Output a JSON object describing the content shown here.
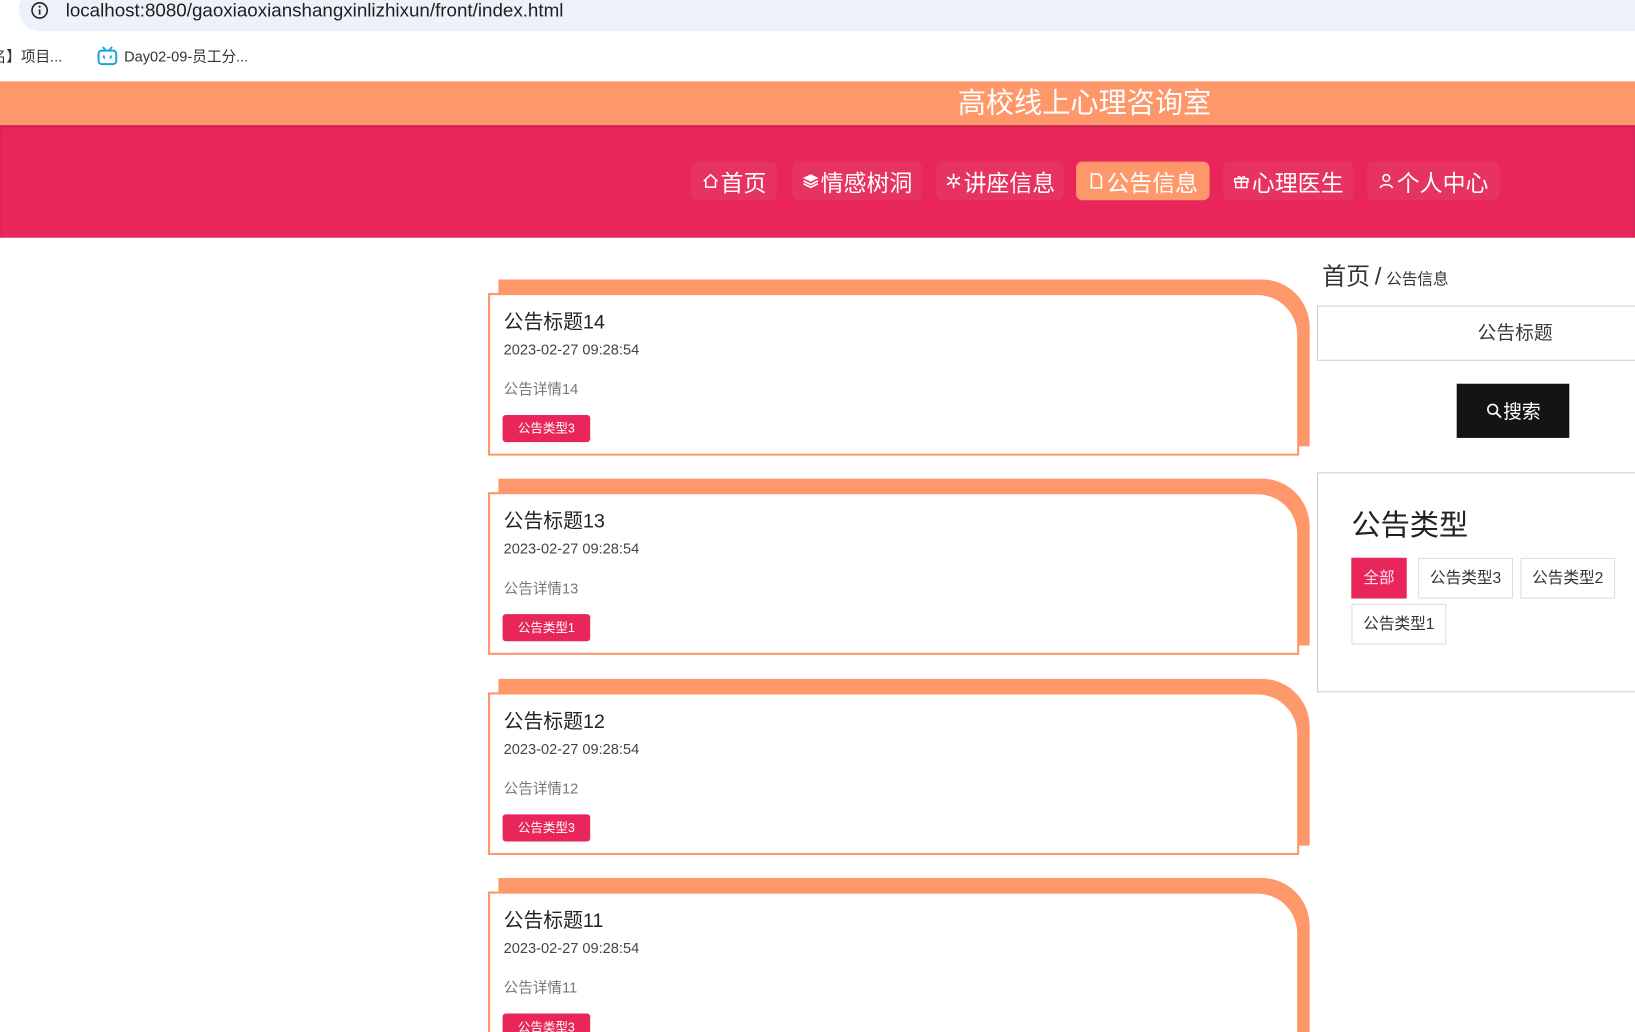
{
  "browser": {
    "url": "localhost:8080/gaoxiaoxianshangxinlizhixun/front/index.html",
    "bookmarks": [
      {
        "label": "名】项目...",
        "icon": "none"
      },
      {
        "label": "Day02-09-员工分...",
        "icon": "bilibili-tv-icon"
      }
    ]
  },
  "site": {
    "title": "高校线上心理咨询室"
  },
  "nav": [
    {
      "label": "首页",
      "icon": "home-icon",
      "active": false
    },
    {
      "label": "情感树洞",
      "icon": "layers-icon",
      "active": false
    },
    {
      "label": "讲座信息",
      "icon": "asterisk-icon",
      "active": false
    },
    {
      "label": "公告信息",
      "icon": "document-icon",
      "active": true
    },
    {
      "label": "心理医生",
      "icon": "gift-icon",
      "active": false
    },
    {
      "label": "个人中心",
      "icon": "user-icon",
      "active": false
    }
  ],
  "breadcrumb": {
    "home": "首页",
    "separator": "/",
    "current": "公告信息"
  },
  "search": {
    "placeholder": "公告标题",
    "button_label": "搜索"
  },
  "categories": {
    "title": "公告类型",
    "items": [
      {
        "label": "全部",
        "active": true
      },
      {
        "label": "公告类型3",
        "active": false
      },
      {
        "label": "公告类型2",
        "active": false
      },
      {
        "label": "公告类型1",
        "active": false
      }
    ]
  },
  "notices": [
    {
      "title": "公告标题14",
      "date": "2023-02-27 09:28:54",
      "detail": "公告详情14",
      "type": "公告类型3"
    },
    {
      "title": "公告标题13",
      "date": "2023-02-27 09:28:54",
      "detail": "公告详情13",
      "type": "公告类型1"
    },
    {
      "title": "公告标题12",
      "date": "2023-02-27 09:28:54",
      "detail": "公告详情12",
      "type": "公告类型3"
    },
    {
      "title": "公告标题11",
      "date": "2023-02-27 09:28:54",
      "detail": "公告详情11",
      "type": "公告类型3"
    }
  ],
  "colors": {
    "orange": "#fe986b",
    "crimson": "#e8265a",
    "dark": "#141414"
  }
}
